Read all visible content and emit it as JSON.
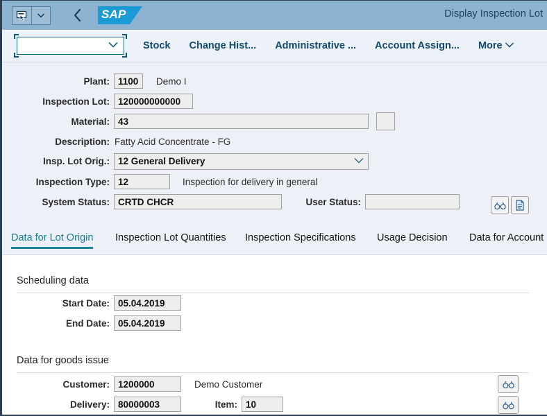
{
  "shell": {
    "title": "Display Inspection Lot",
    "icons": {
      "select_cursor": "select-cursor-icon",
      "dropdown": "chevron-down-icon",
      "back": "back-chevron-icon",
      "logo": "sap-logo"
    },
    "logo_text": "SAP"
  },
  "toolbar": {
    "select_value": "",
    "items": [
      {
        "label": "Stock",
        "name": "toolbar-stock"
      },
      {
        "label": "Change Hist...",
        "name": "toolbar-change-history"
      },
      {
        "label": "Administrative ...",
        "name": "toolbar-administrative"
      },
      {
        "label": "Account Assign...",
        "name": "toolbar-account-assignment"
      },
      {
        "label": "More",
        "name": "toolbar-more"
      }
    ]
  },
  "header_form": {
    "plant": {
      "label": "Plant:",
      "value": "1100",
      "description": "Demo I"
    },
    "inspection_lot": {
      "label": "Inspection Lot:",
      "value": "120000000000"
    },
    "material": {
      "label": "Material:",
      "value": "43"
    },
    "description": {
      "label": "Description:",
      "value": "Fatty Acid Concentrate - FG"
    },
    "insp_lot_orig": {
      "label": "Insp. Lot Orig.:",
      "value": "12 General Delivery"
    },
    "inspection_type": {
      "label": "Inspection Type:",
      "value": "12",
      "description": "Inspection for delivery in general"
    },
    "system_status": {
      "label": "System Status:",
      "value": "CRTD CHCR"
    },
    "user_status": {
      "label": "User Status:",
      "value": ""
    }
  },
  "tabs": [
    {
      "label": "Data for Lot Origin",
      "name": "tab-data-for-lot-origin",
      "active": true
    },
    {
      "label": "Inspection Lot Quantities",
      "name": "tab-inspection-lot-quantities",
      "active": false
    },
    {
      "label": "Inspection Specifications",
      "name": "tab-inspection-specifications",
      "active": false
    },
    {
      "label": "Usage Decision",
      "name": "tab-usage-decision",
      "active": false
    },
    {
      "label": "Data for Account",
      "name": "tab-data-for-account",
      "active": false
    }
  ],
  "scheduling": {
    "title": "Scheduling data",
    "start_date": {
      "label": "Start Date:",
      "value": "05.04.2019"
    },
    "end_date": {
      "label": "End Date:",
      "value": "05.04.2019"
    }
  },
  "goods_issue": {
    "title": "Data for goods issue",
    "customer": {
      "label": "Customer:",
      "value": "1200000",
      "description": "Demo Customer"
    },
    "delivery": {
      "label": "Delivery:",
      "value": "80000003"
    },
    "item": {
      "label": "Item:",
      "value": "10"
    }
  },
  "icon_names": {
    "binoculars": "binoculars-icon",
    "document": "document-icon",
    "info": "info-icon",
    "chevron_down": "chevron-down-icon"
  },
  "colors": {
    "shell_header": "#8cb3d0",
    "toolbar_bg": "#edf2f8",
    "form_bg": "#edf1f7",
    "accent": "#17849b",
    "sap_blue": "#1b9ad6",
    "link_text": "#114a6b"
  }
}
